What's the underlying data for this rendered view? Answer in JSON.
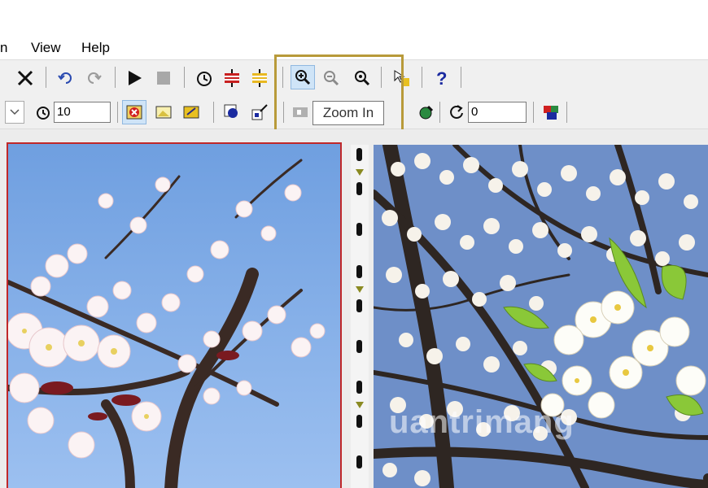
{
  "menu": {
    "partial_item": "n",
    "view": "View",
    "help": "Help"
  },
  "toolbar1": {
    "tools": [
      "close-icon",
      "undo-icon",
      "redo-icon",
      "play-icon",
      "stop-icon",
      "timer-icon",
      "filmstrip-red-icon",
      "filmstrip-yellow-icon",
      "zoom-in-icon",
      "zoom-out-icon",
      "zoom-fit-icon",
      "pointer-icon",
      "help-icon"
    ]
  },
  "toolbar2": {
    "delay_value": "10",
    "rotate_value": "0"
  },
  "tooltip": {
    "text": "Zoom In"
  },
  "watermark": {
    "text": "uantrimang"
  }
}
